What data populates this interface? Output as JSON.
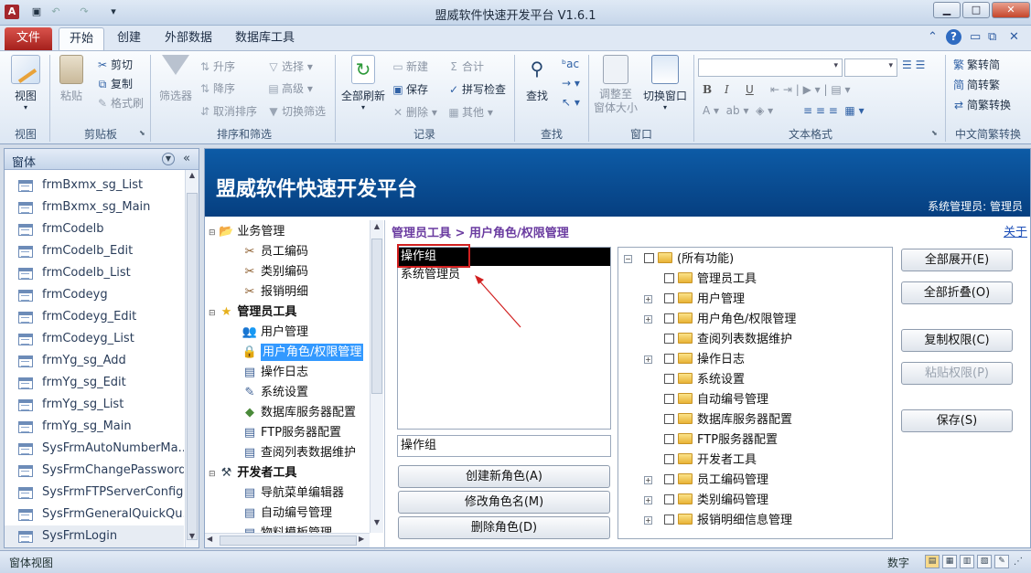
{
  "window": {
    "title": "盟威软件快速开发平台 V1.6.1",
    "app_logo": "A",
    "minimize": "▁",
    "maximize": "□",
    "close": "✕"
  },
  "ribbon": {
    "tabs": [
      "文件",
      "开始",
      "创建",
      "外部数据",
      "数据库工具"
    ],
    "active_tab": "开始",
    "groups": {
      "view": {
        "title": "视图",
        "button": "视图"
      },
      "clipboard": {
        "title": "剪贴板",
        "paste": "粘贴",
        "cut": "剪切",
        "copy": "复制",
        "format_painter": "格式刷"
      },
      "sort_filter": {
        "title": "排序和筛选",
        "filter": "筛选器",
        "ascending": "升序",
        "descending": "降序",
        "clear_sort": "取消排序",
        "selection": "选择",
        "advanced": "高级",
        "toggle_filter": "切换筛选"
      },
      "records": {
        "title": "记录",
        "refresh_all": "全部刷新",
        "new": "新建",
        "save": "保存",
        "delete": "删除",
        "totals": "合计",
        "spelling": "拼写检查",
        "more": "其他"
      },
      "find": {
        "title": "查找",
        "find": "查找"
      },
      "window": {
        "title": "窗口",
        "size_to_fit": "调整至\n窗体大小",
        "switch_windows": "切换窗口"
      },
      "text_format": {
        "title": "文本格式",
        "bold": "B",
        "italic": "I",
        "underline": "U"
      },
      "chinese_conversion": {
        "title": "中文简繁转换",
        "to_simplified": "繁转简",
        "to_traditional": "简转繁",
        "conversion": "简繁转换"
      }
    }
  },
  "nav_pane": {
    "header": "窗体",
    "items": [
      "frmBxmx_sg_List",
      "frmBxmx_sg_Main",
      "frmCodelb",
      "frmCodelb_Edit",
      "frmCodelb_List",
      "frmCodeyg",
      "frmCodeyg_Edit",
      "frmCodeyg_List",
      "frmYg_sg_Add",
      "frmYg_sg_Edit",
      "frmYg_sg_List",
      "frmYg_sg_Main",
      "SysFrmAutoNumberMa...",
      "SysFrmChangePassword",
      "SysFrmFTPServerConfig",
      "SysFrmGeneralQuickQu...",
      "SysFrmLogin"
    ],
    "selected_index": 16
  },
  "form": {
    "banner_title": "盟威软件快速开发平台",
    "banner_user": "系统管理员: 管理员",
    "breadcrumb": "管理员工具 > 用户角色/权限管理",
    "close_link": "关于",
    "menu_tree": [
      {
        "label": "业务管理",
        "level": 0,
        "icon": "folder-open-icon",
        "bold": false
      },
      {
        "label": "员工编码",
        "level": 1,
        "icon": "tools-icon"
      },
      {
        "label": "类别编码",
        "level": 1,
        "icon": "tools-icon"
      },
      {
        "label": "报销明细",
        "level": 1,
        "icon": "tools-icon"
      },
      {
        "label": "管理员工具",
        "level": 0,
        "icon": "star-icon",
        "bold": true
      },
      {
        "label": "用户管理",
        "level": 1,
        "icon": "users-icon"
      },
      {
        "label": "用户角色/权限管理",
        "level": 1,
        "icon": "lock-icon",
        "selected": true
      },
      {
        "label": "操作日志",
        "level": 1,
        "icon": "document-icon"
      },
      {
        "label": "系统设置",
        "level": 1,
        "icon": "settings-icon"
      },
      {
        "label": "数据库服务器配置",
        "level": 1,
        "icon": "database-icon"
      },
      {
        "label": "FTP服务器配置",
        "level": 1,
        "icon": "document-icon"
      },
      {
        "label": "查阅列表数据维护",
        "level": 1,
        "icon": "document-icon"
      },
      {
        "label": "开发者工具",
        "level": 0,
        "icon": "developer-icon",
        "bold": true
      },
      {
        "label": "导航菜单编辑器",
        "level": 1,
        "icon": "document-icon"
      },
      {
        "label": "自动编号管理",
        "level": 1,
        "icon": "document-icon"
      },
      {
        "label": "物料模板管理",
        "level": 1,
        "icon": "document-icon"
      }
    ],
    "roles": [
      "操作组",
      "系统管理员"
    ],
    "selected_role": "操作组",
    "role_name_input": "操作组",
    "role_buttons": {
      "create": "创建新角色(A)",
      "rename": "修改角色名(M)",
      "delete": "删除角色(D)"
    },
    "permission_tree": [
      {
        "label": "(所有功能)",
        "expand": "−"
      },
      {
        "label": "管理员工具",
        "expand": ""
      },
      {
        "label": "用户管理",
        "expand": "+"
      },
      {
        "label": "用户角色/权限管理",
        "expand": "+"
      },
      {
        "label": "查阅列表数据维护",
        "expand": ""
      },
      {
        "label": "操作日志",
        "expand": "+"
      },
      {
        "label": "系统设置",
        "expand": ""
      },
      {
        "label": "自动编号管理",
        "expand": ""
      },
      {
        "label": "数据库服务器配置",
        "expand": ""
      },
      {
        "label": "FTP服务器配置",
        "expand": ""
      },
      {
        "label": "开发者工具",
        "expand": ""
      },
      {
        "label": "员工编码管理",
        "expand": "+"
      },
      {
        "label": "类别编码管理",
        "expand": "+"
      },
      {
        "label": "报销明细信息管理",
        "expand": "+"
      }
    ],
    "action_buttons": {
      "expand_all": "全部展开(E)",
      "collapse_all": "全部折叠(O)",
      "copy_perm": "复制权限(C)",
      "paste_perm": "粘贴权限(P)",
      "save": "保存(S)"
    }
  },
  "statusbar": {
    "left": "窗体视图",
    "num": "数字"
  },
  "colors": {
    "banner": "#0a4f98",
    "accent_file": "#c0392b",
    "selection": "#3399ff",
    "highlight_box": "#d11f1f"
  }
}
